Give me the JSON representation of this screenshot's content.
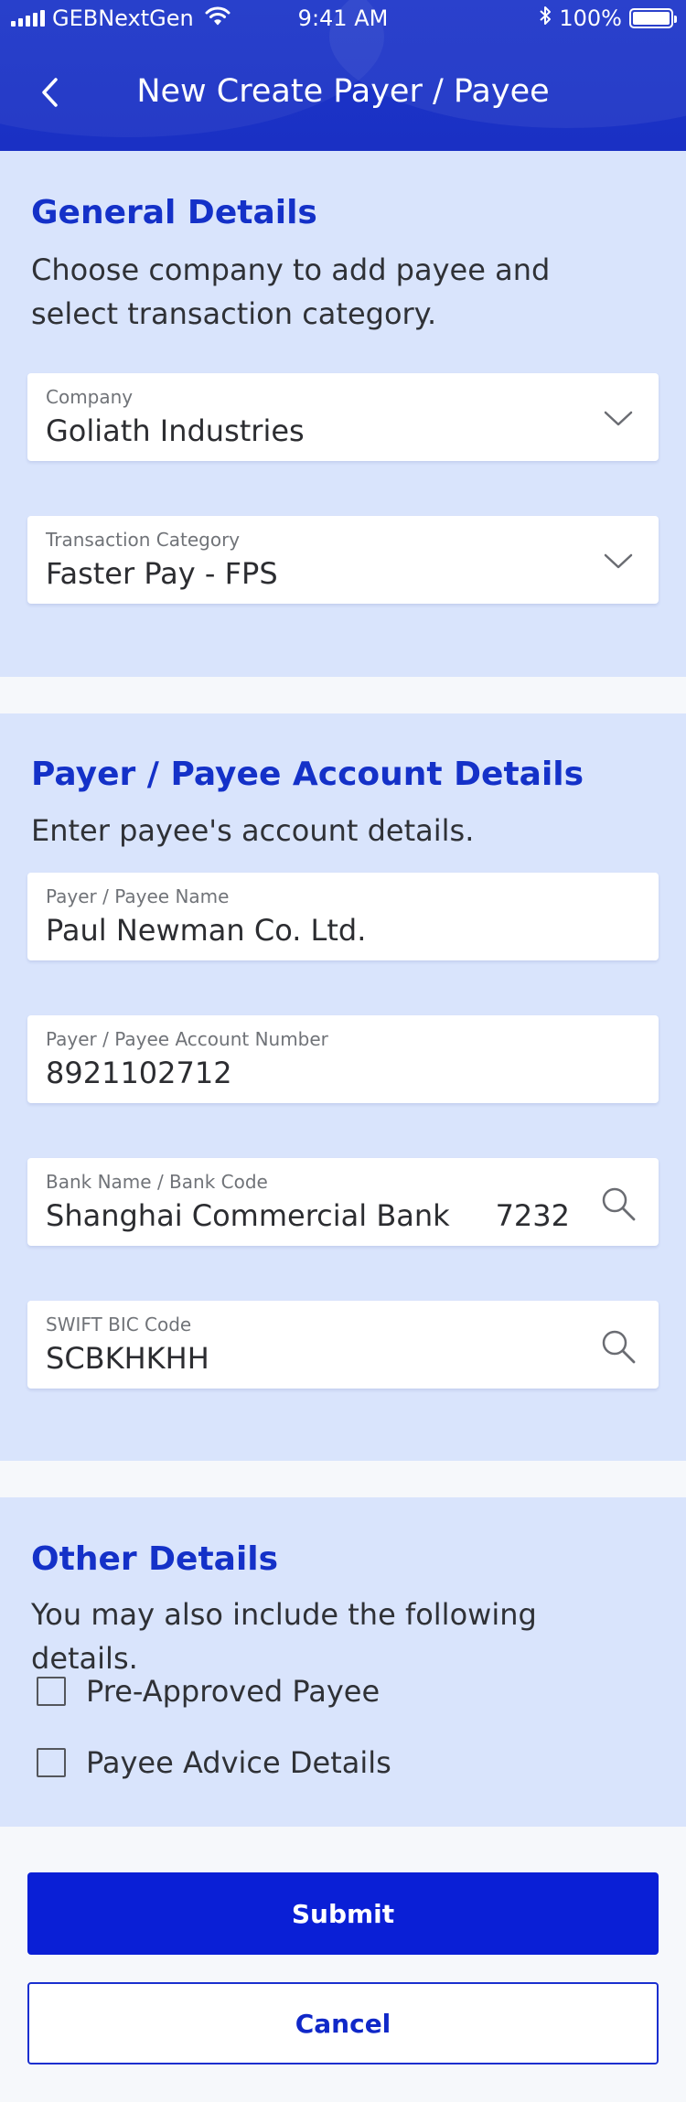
{
  "status_bar": {
    "carrier": "GEBNextGen",
    "time": "9:41 AM",
    "battery": "100%",
    "battery_level": 1.0
  },
  "header": {
    "title": "New Create Payer / Payee",
    "back_icon": "chevron-left-icon"
  },
  "general": {
    "title": "General Details",
    "description": "Choose company to add payee and select transaction category.",
    "company": {
      "label": "Company",
      "value": "Goliath Industries"
    },
    "category": {
      "label": "Transaction Category",
      "value": "Faster Pay - FPS"
    }
  },
  "account": {
    "title": "Payer / Payee Account Details",
    "description": "Enter payee's account details.",
    "name": {
      "label": "Payer / Payee Name",
      "value": "Paul Newman Co. Ltd."
    },
    "number": {
      "label": "Payer / Payee Account Number",
      "value": "8921102712"
    },
    "bank": {
      "label": "Bank Name / Bank Code",
      "value": "Shanghai Commercial Bank",
      "code": "7232"
    },
    "swift": {
      "label": "SWIFT BIC Code",
      "value": "SCBKHKHH"
    }
  },
  "other": {
    "title": "Other Details",
    "description": "You may also include the following details.",
    "options": [
      {
        "label": "Pre-Approved Payee",
        "checked": false
      },
      {
        "label": "Payee Advice Details",
        "checked": false
      }
    ]
  },
  "actions": {
    "submit": "Submit",
    "cancel": "Cancel"
  },
  "colors": {
    "header_bg": "#1a30c4",
    "section_bg": "#d9e4fc",
    "accent": "#1431c8",
    "submit_bg": "#0a1fd6"
  }
}
